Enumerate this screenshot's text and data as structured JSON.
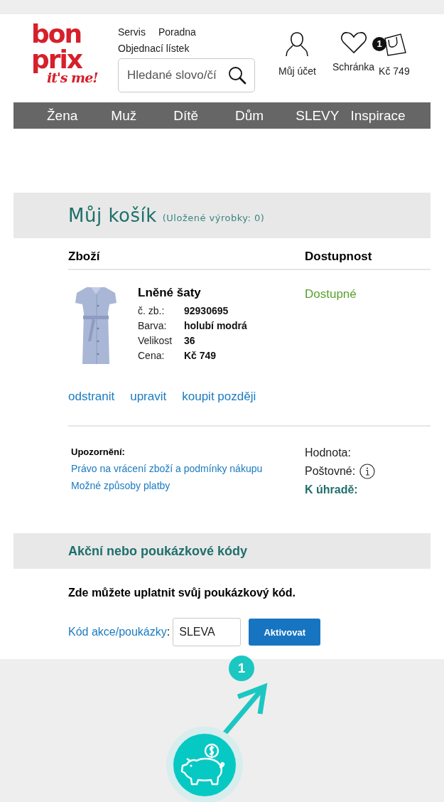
{
  "logo": {
    "line_1": "bon",
    "line_2": "prix",
    "tagline": "it's me!"
  },
  "top_links": [
    "Servis",
    "Poradna",
    "Objednací lístek"
  ],
  "search": {
    "placeholder": "Hledané slovo/čí"
  },
  "account": {
    "label": "Můj účet"
  },
  "wishlist": {
    "label": "Schránka"
  },
  "cart": {
    "badge": "1",
    "total": "Kč 749"
  },
  "nav": [
    "Žena",
    "Muž",
    "Dítě",
    "Dům",
    "SLEVY",
    "Inspirace"
  ],
  "basket": {
    "title": "Můj košík",
    "saved": "(Uložené výrobky: 0)",
    "columns": [
      "Zboží",
      "Dostupnost"
    ],
    "items": [
      {
        "name": "Lněné šaty",
        "details": [
          {
            "label": "č. zb.:",
            "value": "92930695"
          },
          {
            "label": "Barva:",
            "value": "holubí modrá"
          },
          {
            "label": "Velikost",
            "value": "36"
          },
          {
            "label": "Cena:",
            "value": "Kč 749"
          }
        ],
        "availability": "Dostupné",
        "actions": [
          "odstranit",
          "upravit",
          "koupit později"
        ]
      }
    ]
  },
  "notice": {
    "title": "Upozornění:",
    "links": [
      "Právo na vrácení zboží a podmínky nákupu",
      "Možné způsoby platby"
    ]
  },
  "totals": [
    {
      "label": "Hodnota:",
      "kind": "plain"
    },
    {
      "label": "Poštovné:",
      "kind": "info"
    },
    {
      "label": "K úhradě:",
      "kind": "total"
    }
  ],
  "promo": {
    "title": "Akční nebo poukázkové kódy",
    "intro": "Zde můžete uplatnit svůj poukázkový kód.",
    "code_label": "Kód akce/poukázky",
    "code_suffix": ":",
    "value": "SLEVA",
    "button": "Aktivovat"
  },
  "annotation": {
    "step": "1"
  }
}
